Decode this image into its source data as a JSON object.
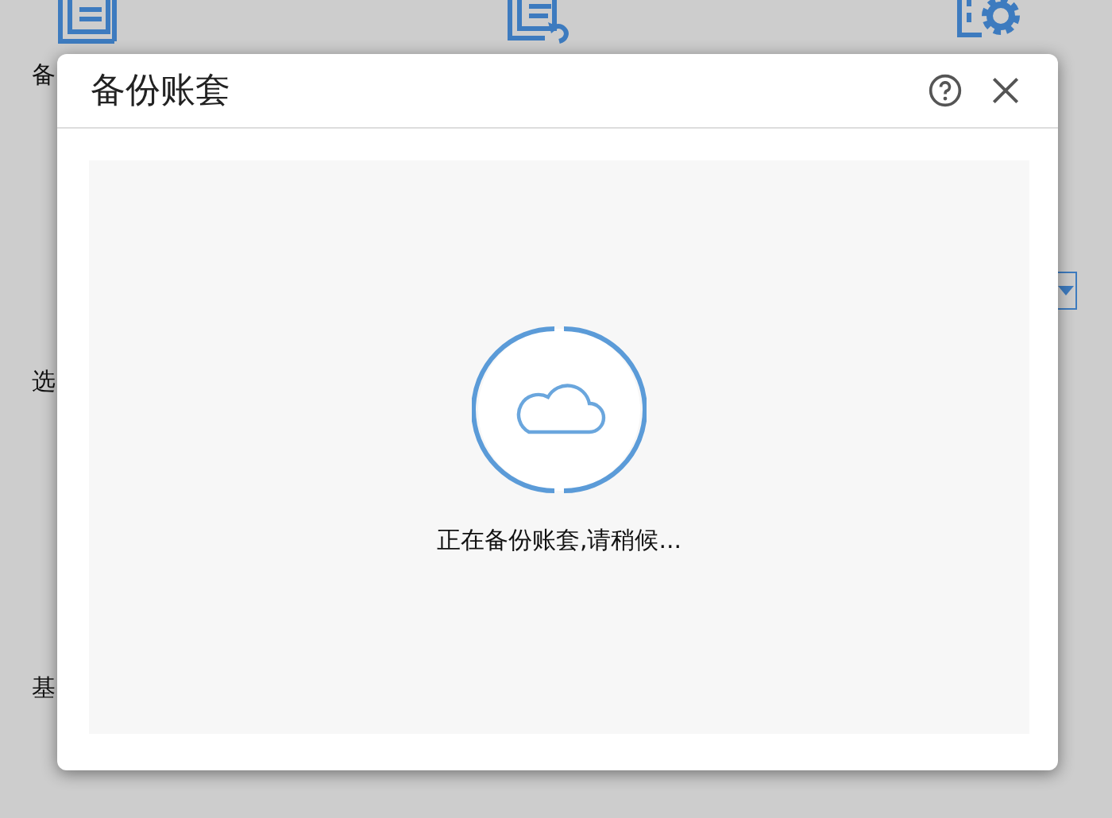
{
  "background": {
    "labels": [
      {
        "text": "备"
      },
      {
        "text": "选"
      },
      {
        "text": "基"
      }
    ]
  },
  "dialog": {
    "title": "备份账套",
    "message": "正在备份账套,请稍候..."
  }
}
